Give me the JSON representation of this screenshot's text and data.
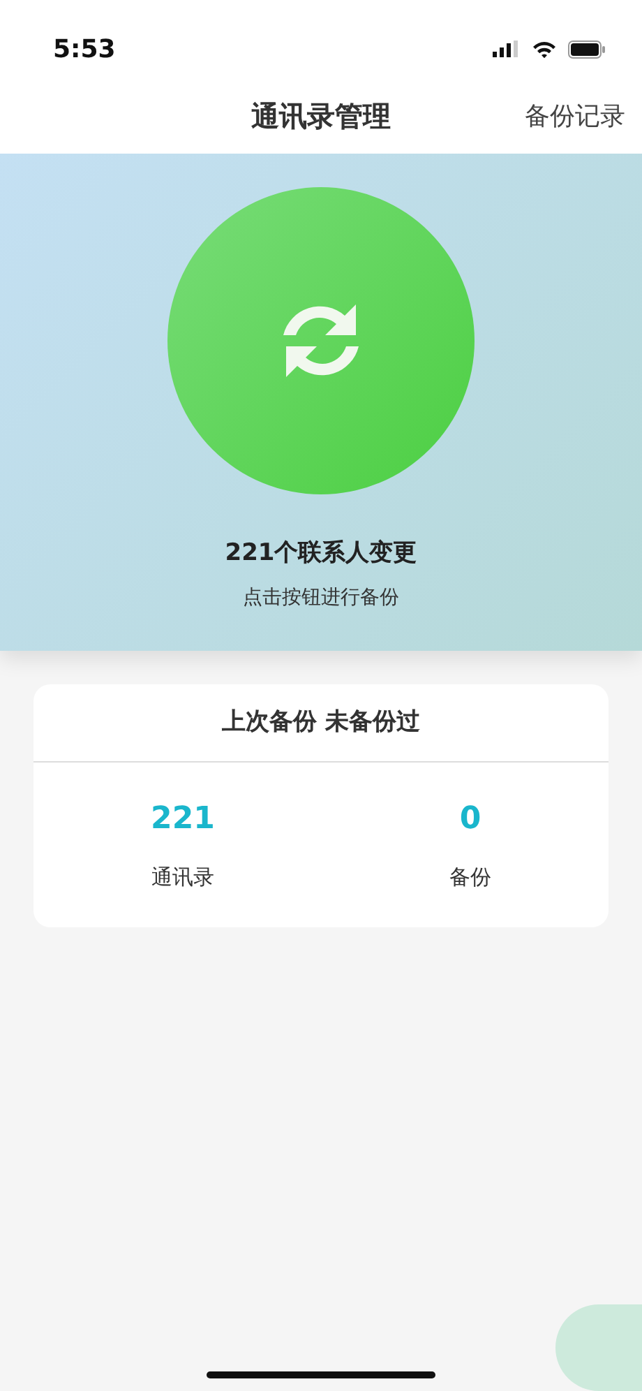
{
  "status_bar": {
    "time": "5:53"
  },
  "nav": {
    "title": "通讯录管理",
    "action": "备份记录"
  },
  "hero": {
    "headline": "221个联系人变更",
    "hint": "点击按钮进行备份"
  },
  "summary": {
    "title": "上次备份 未备份过",
    "stats": [
      {
        "value": "221",
        "label": "通讯录"
      },
      {
        "value": "0",
        "label": "备份"
      }
    ]
  }
}
